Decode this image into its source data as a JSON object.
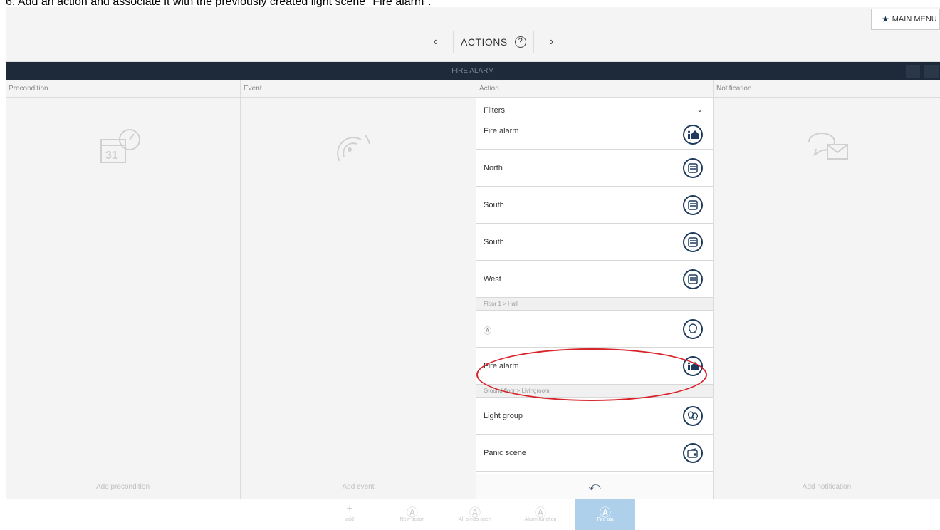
{
  "caption": "6.   Add an action and associate it with the previously created light scene \"Fire alarm\".",
  "header": {
    "title": "ACTIONS",
    "help_icon": "help-icon",
    "prev_icon": "chevron-left-icon",
    "next_icon": "chevron-right-icon",
    "main_menu_label": "MAIN MENU"
  },
  "darkbar": {
    "title": "FIRE ALARM"
  },
  "columns": {
    "precondition": {
      "label": "Precondition",
      "footer": "Add precondition"
    },
    "event": {
      "label": "Event",
      "footer": "Add event"
    },
    "action": {
      "label": "Action"
    },
    "notification": {
      "label": "Notification",
      "footer": "Add notification"
    }
  },
  "action_panel": {
    "filters_label": "Filters",
    "items": [
      {
        "label": "Fire alarm",
        "icon": "fire-alarm-scene-icon"
      },
      {
        "label": "North",
        "icon": "blind-icon"
      },
      {
        "label": "South",
        "icon": "blind-icon"
      },
      {
        "label": "South",
        "icon": "blind-icon"
      },
      {
        "label": "West",
        "icon": "blind-icon"
      }
    ],
    "group1": "Floor 1 > Hall",
    "group1_items": [
      {
        "label": "Ⓐ",
        "icon": "light-bulb-icon"
      },
      {
        "label": "Fire alarm",
        "icon": "fire-alarm-scene-icon"
      }
    ],
    "group2": "Ground floor > Livingroom",
    "group2_items": [
      {
        "label": "Light group",
        "icon": "light-group-icon"
      },
      {
        "label": "Panic scene",
        "icon": "panic-scene-icon"
      }
    ]
  },
  "toolbar": {
    "tools": [
      {
        "label": "add",
        "icon": "plus-icon"
      },
      {
        "label": "New action",
        "icon": "action-icon"
      },
      {
        "label": "All blinds open",
        "icon": "action-icon"
      },
      {
        "label": "Alarm function",
        "icon": "action-icon"
      },
      {
        "label": "Fire ala",
        "icon": "action-icon"
      }
    ]
  },
  "colors": {
    "dark_bar": "#1e2a3a",
    "icon_navy": "#1e3a5f",
    "highlight": "#d8232a",
    "active_tool": "#aed0ea"
  }
}
